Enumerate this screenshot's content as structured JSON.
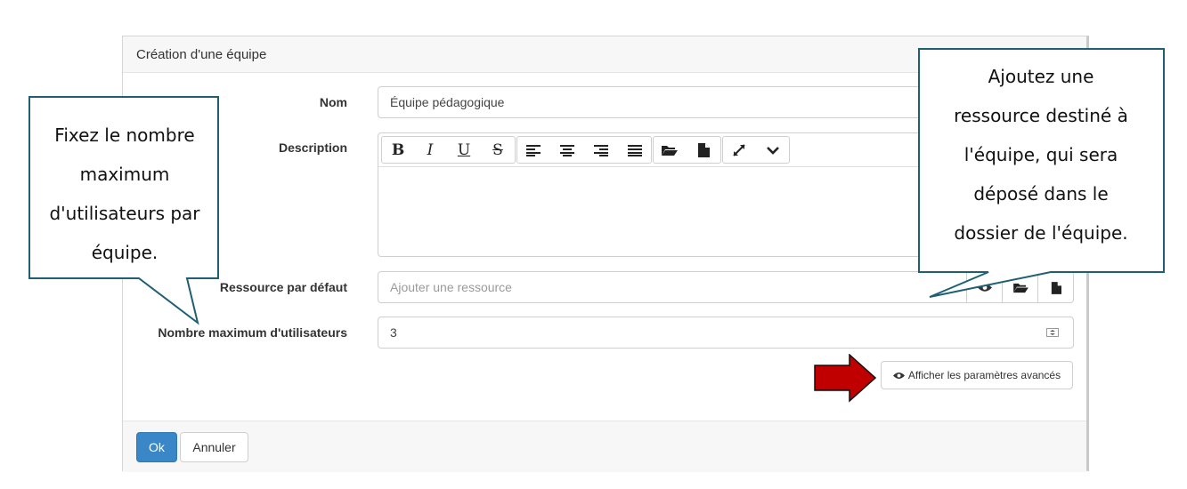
{
  "modal": {
    "title": "Création d'une équipe",
    "fields": {
      "name_label": "Nom",
      "name_value": "Équipe pédagogique",
      "description_label": "Description",
      "resource_label": "Ressource par défaut",
      "resource_placeholder": "Ajouter une ressource",
      "max_users_label": "Nombre maximum d'utilisateurs",
      "max_users_value": "3"
    },
    "toolbar": {
      "bold": "B",
      "italic": "I",
      "underline": "U",
      "strike": "S"
    },
    "advanced_button": "Afficher les paramètres avancés",
    "footer": {
      "ok": "Ok",
      "cancel": "Annuler"
    },
    "colors": {
      "primary": "#3a87c8",
      "arrow": "#c00000",
      "callout_border": "#1f5f73"
    }
  },
  "callouts": {
    "left": [
      "Fixez le nombre",
      "maximum",
      "d'utilisateurs par",
      "équipe."
    ],
    "right": [
      "Ajoutez  une",
      "ressource  destiné à",
      "l'équipe, qui sera",
      "déposé dans le",
      "dossier de l'équipe."
    ]
  }
}
